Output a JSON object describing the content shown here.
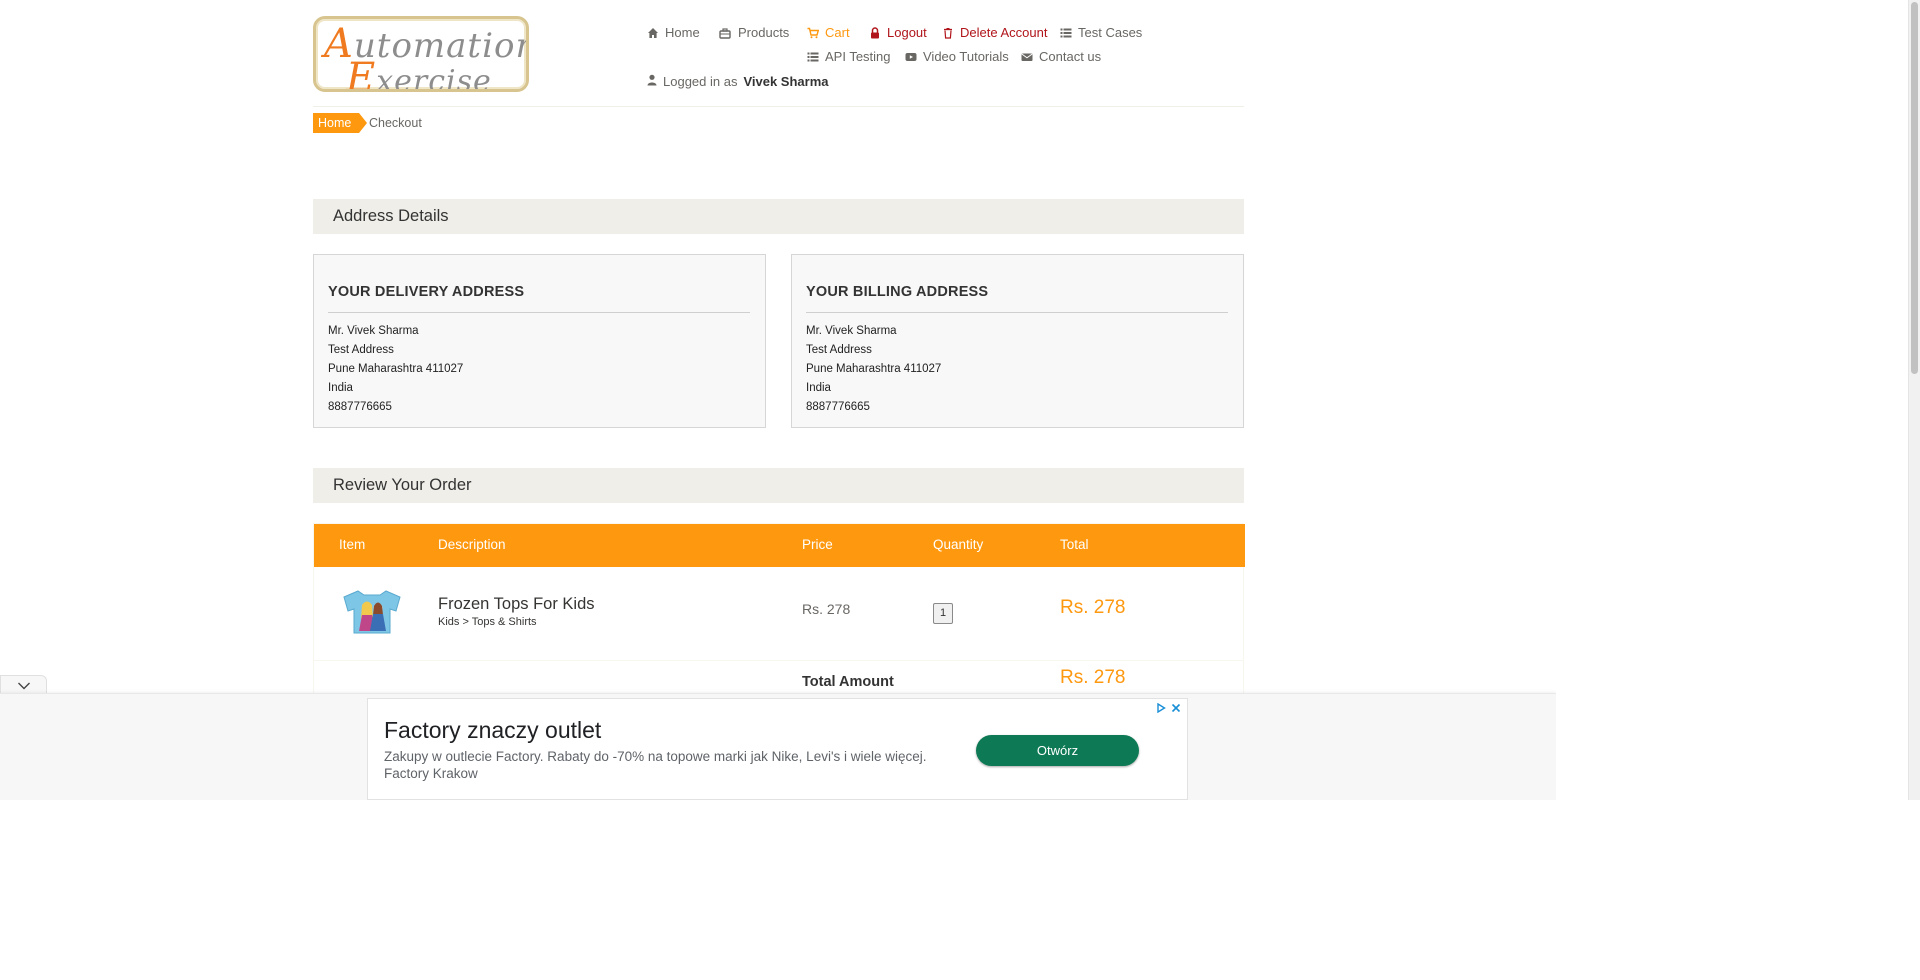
{
  "header": {
    "logo_line1": "Automation",
    "logo_line2": "Exercise",
    "nav": [
      {
        "label": "Home",
        "icon": "home-icon"
      },
      {
        "label": "Products",
        "icon": "briefcase-icon"
      },
      {
        "label": "Cart",
        "icon": "shopping-cart-icon"
      },
      {
        "label": "Logout",
        "icon": "lock-icon"
      },
      {
        "label": "Delete Account",
        "icon": "trash-icon"
      },
      {
        "label": "Test Cases",
        "icon": "list-icon"
      },
      {
        "label": "API Testing",
        "icon": "list-icon"
      },
      {
        "label": "Video Tutorials",
        "icon": "youtube-play-icon"
      },
      {
        "label": "Contact us",
        "icon": "envelope-icon"
      }
    ],
    "logged_in_prefix": "Logged in as",
    "logged_in_user": "Vivek Sharma"
  },
  "breadcrumb": {
    "home": "Home",
    "current": "Checkout"
  },
  "address_section": {
    "title": "Address Details",
    "delivery": {
      "heading": "YOUR DELIVERY ADDRESS",
      "lines": [
        "Mr. Vivek Sharma",
        "Test Address",
        "Pune Maharashtra 411027",
        "India",
        "8887776665"
      ]
    },
    "billing": {
      "heading": "YOUR BILLING ADDRESS",
      "lines": [
        "Mr. Vivek Sharma",
        "Test Address",
        "Pune Maharashtra 411027",
        "India",
        "8887776665"
      ]
    }
  },
  "review_section": {
    "title": "Review Your Order",
    "columns": [
      "Item",
      "Description",
      "Price",
      "Quantity",
      "Total"
    ],
    "items": [
      {
        "name": "Frozen Tops For Kids",
        "category": "Kids > Tops & Shirts",
        "price": "Rs. 278",
        "quantity": "1",
        "total": "Rs. 278"
      }
    ],
    "total_label": "Total Amount",
    "total_value": "Rs. 278"
  },
  "ad": {
    "title": "Factory znaczy outlet",
    "body": "Zakupy w outlecie Factory. Rabaty do -70% na topowe marki jak Nike, Levi's i wiele więcej.",
    "advertiser": "Factory Krakow",
    "cta": "Otwórz"
  },
  "colors": {
    "accent": "#fe980f",
    "danger": "#b0151b",
    "section_bg": "#efeee9",
    "ad_button": "#0d7a55"
  }
}
